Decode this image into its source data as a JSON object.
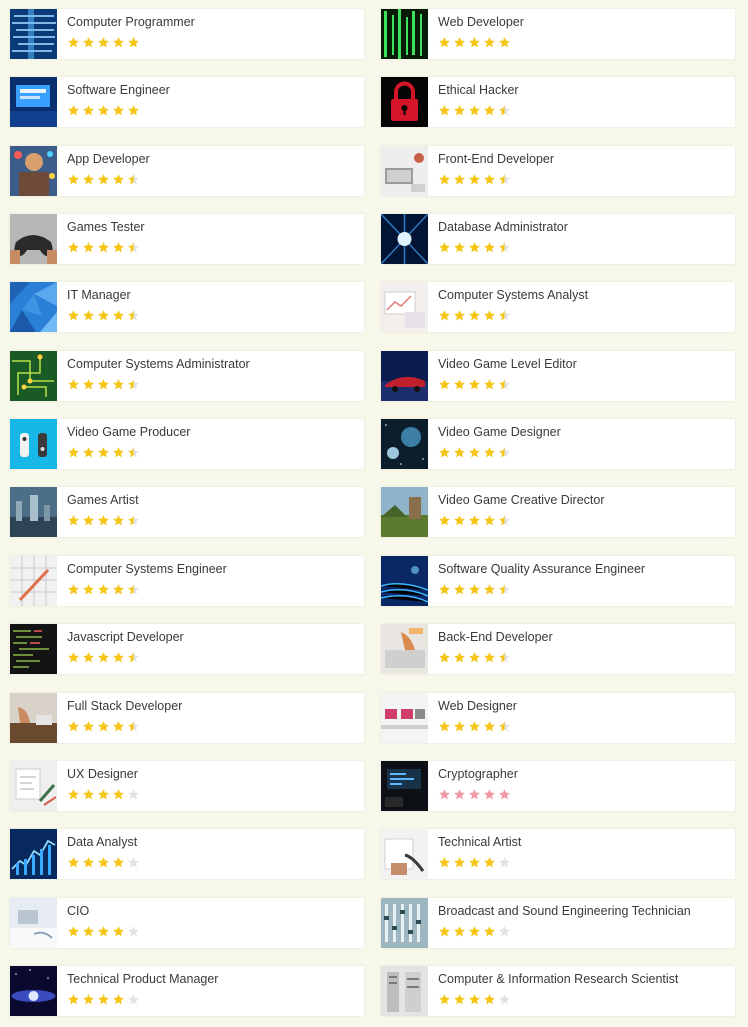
{
  "colors": {
    "star_gold": "#f5c518",
    "star_empty": "#e3e3e3",
    "star_pink": "#f29aa3"
  },
  "careers": [
    {
      "title": "Computer Programmer",
      "rating": 5,
      "star_color": "gold",
      "thumb": "blue-binary"
    },
    {
      "title": "Web Developer",
      "rating": 5,
      "star_color": "gold",
      "thumb": "green-matrix"
    },
    {
      "title": "Software Engineer",
      "rating": 5,
      "star_color": "gold",
      "thumb": "blue-screens"
    },
    {
      "title": "Ethical Hacker",
      "rating": 4.5,
      "star_color": "gold",
      "thumb": "red-padlock"
    },
    {
      "title": "App Developer",
      "rating": 4.5,
      "star_color": "gold",
      "thumb": "person-phone"
    },
    {
      "title": "Front-End Developer",
      "rating": 4.5,
      "star_color": "gold",
      "thumb": "desk-laptop"
    },
    {
      "title": "Games Tester",
      "rating": 4.5,
      "star_color": "gold",
      "thumb": "gamepad-hands"
    },
    {
      "title": "Database Administrator",
      "rating": 4.5,
      "star_color": "gold",
      "thumb": "blue-tunnel"
    },
    {
      "title": "IT Manager",
      "rating": 4.5,
      "star_color": "gold",
      "thumb": "blue-polygons"
    },
    {
      "title": "Computer Systems Analyst",
      "rating": 4.5,
      "star_color": "gold",
      "thumb": "analyst-papers"
    },
    {
      "title": "Computer Systems Administrator",
      "rating": 4.5,
      "star_color": "gold",
      "thumb": "green-circuit"
    },
    {
      "title": "Video Game Level Editor",
      "rating": 4.5,
      "star_color": "gold",
      "thumb": "racing-car"
    },
    {
      "title": "Video Game Producer",
      "rating": 4.5,
      "star_color": "gold",
      "thumb": "cyan-controller"
    },
    {
      "title": "Video Game Designer",
      "rating": 4.5,
      "star_color": "gold",
      "thumb": "space-scene"
    },
    {
      "title": "Games Artist",
      "rating": 4.5,
      "star_color": "gold",
      "thumb": "fantasy-city"
    },
    {
      "title": "Video Game Creative Director",
      "rating": 4.5,
      "star_color": "gold",
      "thumb": "game-landscape"
    },
    {
      "title": "Computer Systems Engineer",
      "rating": 4.5,
      "star_color": "gold",
      "thumb": "blueprint-pencil"
    },
    {
      "title": "Software Quality Assurance Engineer",
      "rating": 4.5,
      "star_color": "gold",
      "thumb": "blue-lines"
    },
    {
      "title": "Javascript Developer",
      "rating": 4.5,
      "star_color": "gold",
      "thumb": "dark-code"
    },
    {
      "title": "Back-End Developer",
      "rating": 4.5,
      "star_color": "gold",
      "thumb": "hands-typing"
    },
    {
      "title": "Full Stack Developer",
      "rating": 4.5,
      "star_color": "gold",
      "thumb": "desk-hands"
    },
    {
      "title": "Web Designer",
      "rating": 4.5,
      "star_color": "gold",
      "thumb": "office-desks"
    },
    {
      "title": "UX Designer",
      "rating": 4,
      "star_color": "gold",
      "thumb": "sketch-paper"
    },
    {
      "title": "Cryptographer",
      "rating": 5,
      "star_color": "pink",
      "thumb": "dark-monitor"
    },
    {
      "title": "Data Analyst",
      "rating": 4,
      "star_color": "gold",
      "thumb": "stock-chart"
    },
    {
      "title": "Technical Artist",
      "rating": 4,
      "star_color": "gold",
      "thumb": "hand-drawing"
    },
    {
      "title": "CIO",
      "rating": 4,
      "star_color": "gold",
      "thumb": "white-desk"
    },
    {
      "title": "Broadcast and Sound Engineering Technician",
      "rating": 4,
      "star_color": "gold",
      "thumb": "sound-board"
    },
    {
      "title": "Technical Product Manager",
      "rating": 4,
      "star_color": "gold",
      "thumb": "galaxy-glow"
    },
    {
      "title": "Computer & Information Research Scientist",
      "rating": 4,
      "star_color": "gold",
      "thumb": "server-room"
    }
  ]
}
